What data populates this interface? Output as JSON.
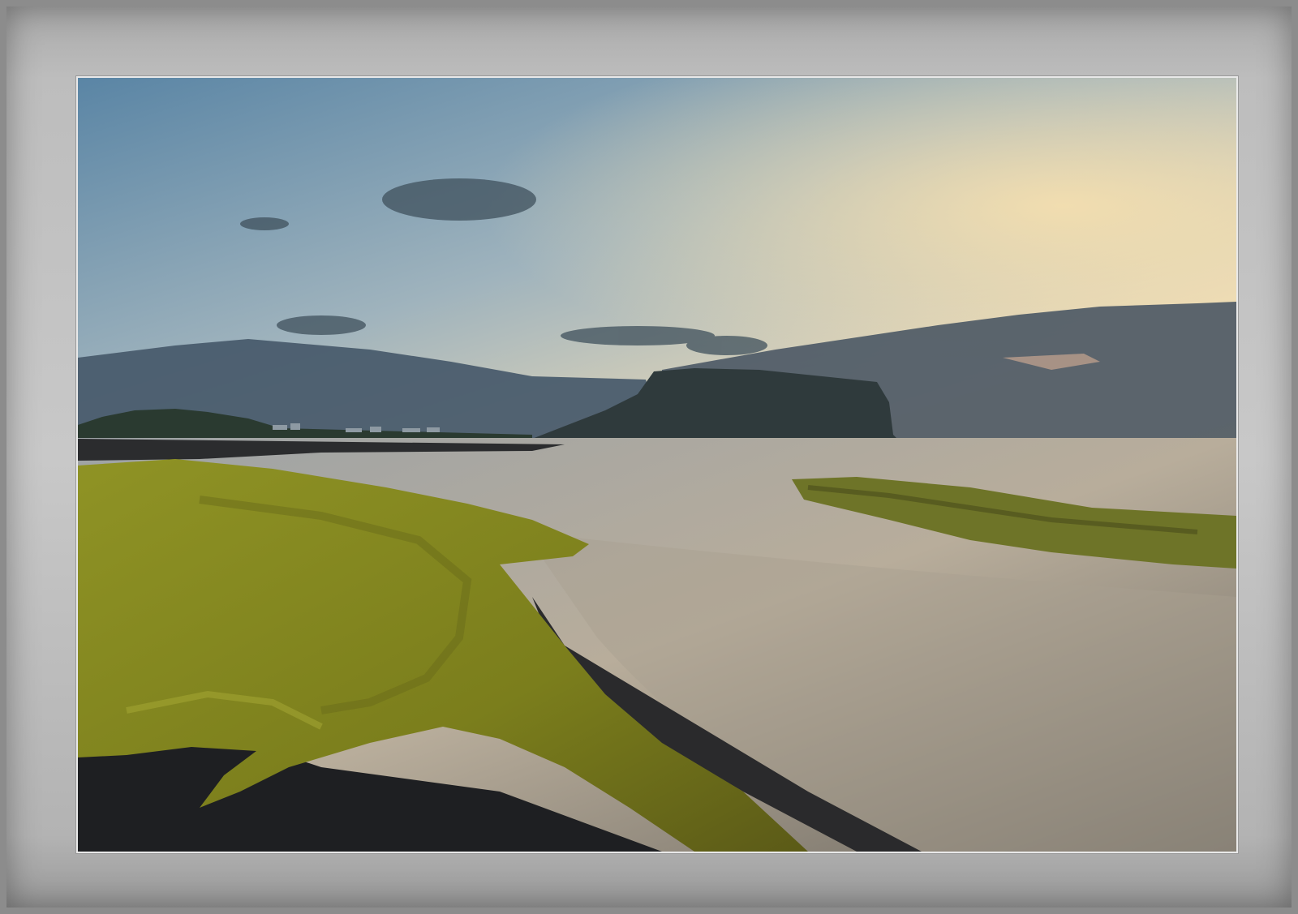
{
  "scene": {
    "subject": "coastal-sunset-photograph",
    "colors": {
      "frame": "#bdbdbd",
      "sky_top": "#5f88a6",
      "sky_glow": "#f3dcb0",
      "cloud": "#3e4f5c",
      "headland": "#2f3a3c",
      "water": "#b9b2a6",
      "moss": "#8a8a1f",
      "sand": "#1f1f22"
    }
  }
}
